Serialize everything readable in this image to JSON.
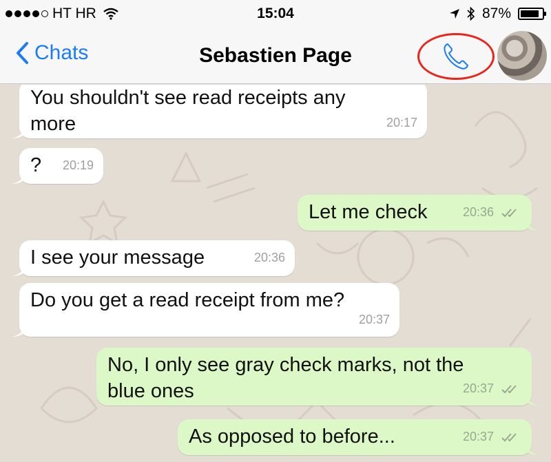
{
  "status_bar": {
    "carrier": "HT HR",
    "time": "15:04",
    "battery": "87%",
    "battery_level": 0.87
  },
  "nav": {
    "back_label": "Chats",
    "title": "Sebastien Page",
    "call_icon": "phone-icon",
    "highlight_color": "#e8261c",
    "accent_color": "#1a7cf7"
  },
  "messages": [
    {
      "direction": "in",
      "text_line1": "You shouldn't see read receipts any",
      "text_line2": "more",
      "time": "20:17"
    },
    {
      "direction": "in",
      "text": "?",
      "time": "20:19"
    },
    {
      "direction": "out",
      "text": "Let me check",
      "time": "20:36"
    },
    {
      "direction": "in",
      "text": "I see your message",
      "time": "20:36"
    },
    {
      "direction": "in",
      "text": "Do you get a read receipt from me?",
      "time": "20:37"
    },
    {
      "direction": "out",
      "text_line1": "No, I only see gray check marks, not the",
      "text_line2": "blue ones",
      "time": "20:37"
    },
    {
      "direction": "out",
      "text": "As opposed to before...",
      "time": "20:37"
    }
  ],
  "colors": {
    "incoming_bubble": "#ffffff",
    "outgoing_bubble": "#dcf8c6",
    "chat_background": "#e4ddd3"
  }
}
